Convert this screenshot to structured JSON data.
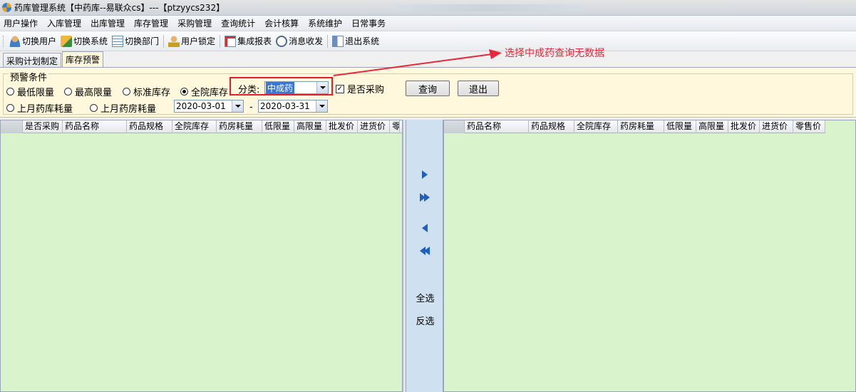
{
  "window": {
    "title": "药库管理系统【中药库--易联众cs】---【ptzyycs232】"
  },
  "menu": {
    "items": [
      "用户操作",
      "入库管理",
      "出库管理",
      "库存管理",
      "采购管理",
      "查询统计",
      "会计核算",
      "系统维护",
      "日常事务"
    ]
  },
  "toolbar": {
    "switch_user": "切换用户",
    "switch_system": "切换系统",
    "switch_dept": "切换部门",
    "user_lock": "用户锁定",
    "integrated_report": "集成报表",
    "message": "消息收发",
    "exit_system": "退出系统"
  },
  "tabs": [
    {
      "label": "采购计划制定",
      "active": false
    },
    {
      "label": "库存预警",
      "active": true
    }
  ],
  "annotation": {
    "text": "选择中成药查询无数据",
    "color": "#e8283c"
  },
  "filter": {
    "group_title": "预警条件",
    "radios": {
      "min_limit": "最低限量",
      "max_limit": "最高限量",
      "standard_stock": "标准库存",
      "hospital_stock": "全院库存",
      "last_month_storage": "上月药库耗量",
      "last_month_pharmacy": "上月药房耗量"
    },
    "selected_radio": "全院库存",
    "category_label": "分类:",
    "category_value": "中成药",
    "purchase_checkbox_label": "是否采购",
    "purchase_checked": true,
    "date_from": "2020-03-01",
    "date_separator": "-",
    "date_to": "2020-03-31",
    "query_button": "查询",
    "exit_button": "退出"
  },
  "left_grid": {
    "columns": [
      "是否采购",
      "药品名称",
      "药品规格",
      "全院库存",
      "药房耗量",
      "低限量",
      "高限量",
      "批发价",
      "进货价",
      "零"
    ]
  },
  "right_grid": {
    "columns": [
      "药品名称",
      "药品规格",
      "全院库存",
      "药房耗量",
      "低限量",
      "高限量",
      "批发价",
      "进货价",
      "零售价"
    ]
  },
  "middle": {
    "select_all": "全选",
    "invert_select": "反选"
  },
  "colors": {
    "grid_bg": "#d9f3cd",
    "filter_bg": "#fff8dc",
    "arrow_blue": "#1f5fbf",
    "highlight_red": "#e0202a"
  }
}
